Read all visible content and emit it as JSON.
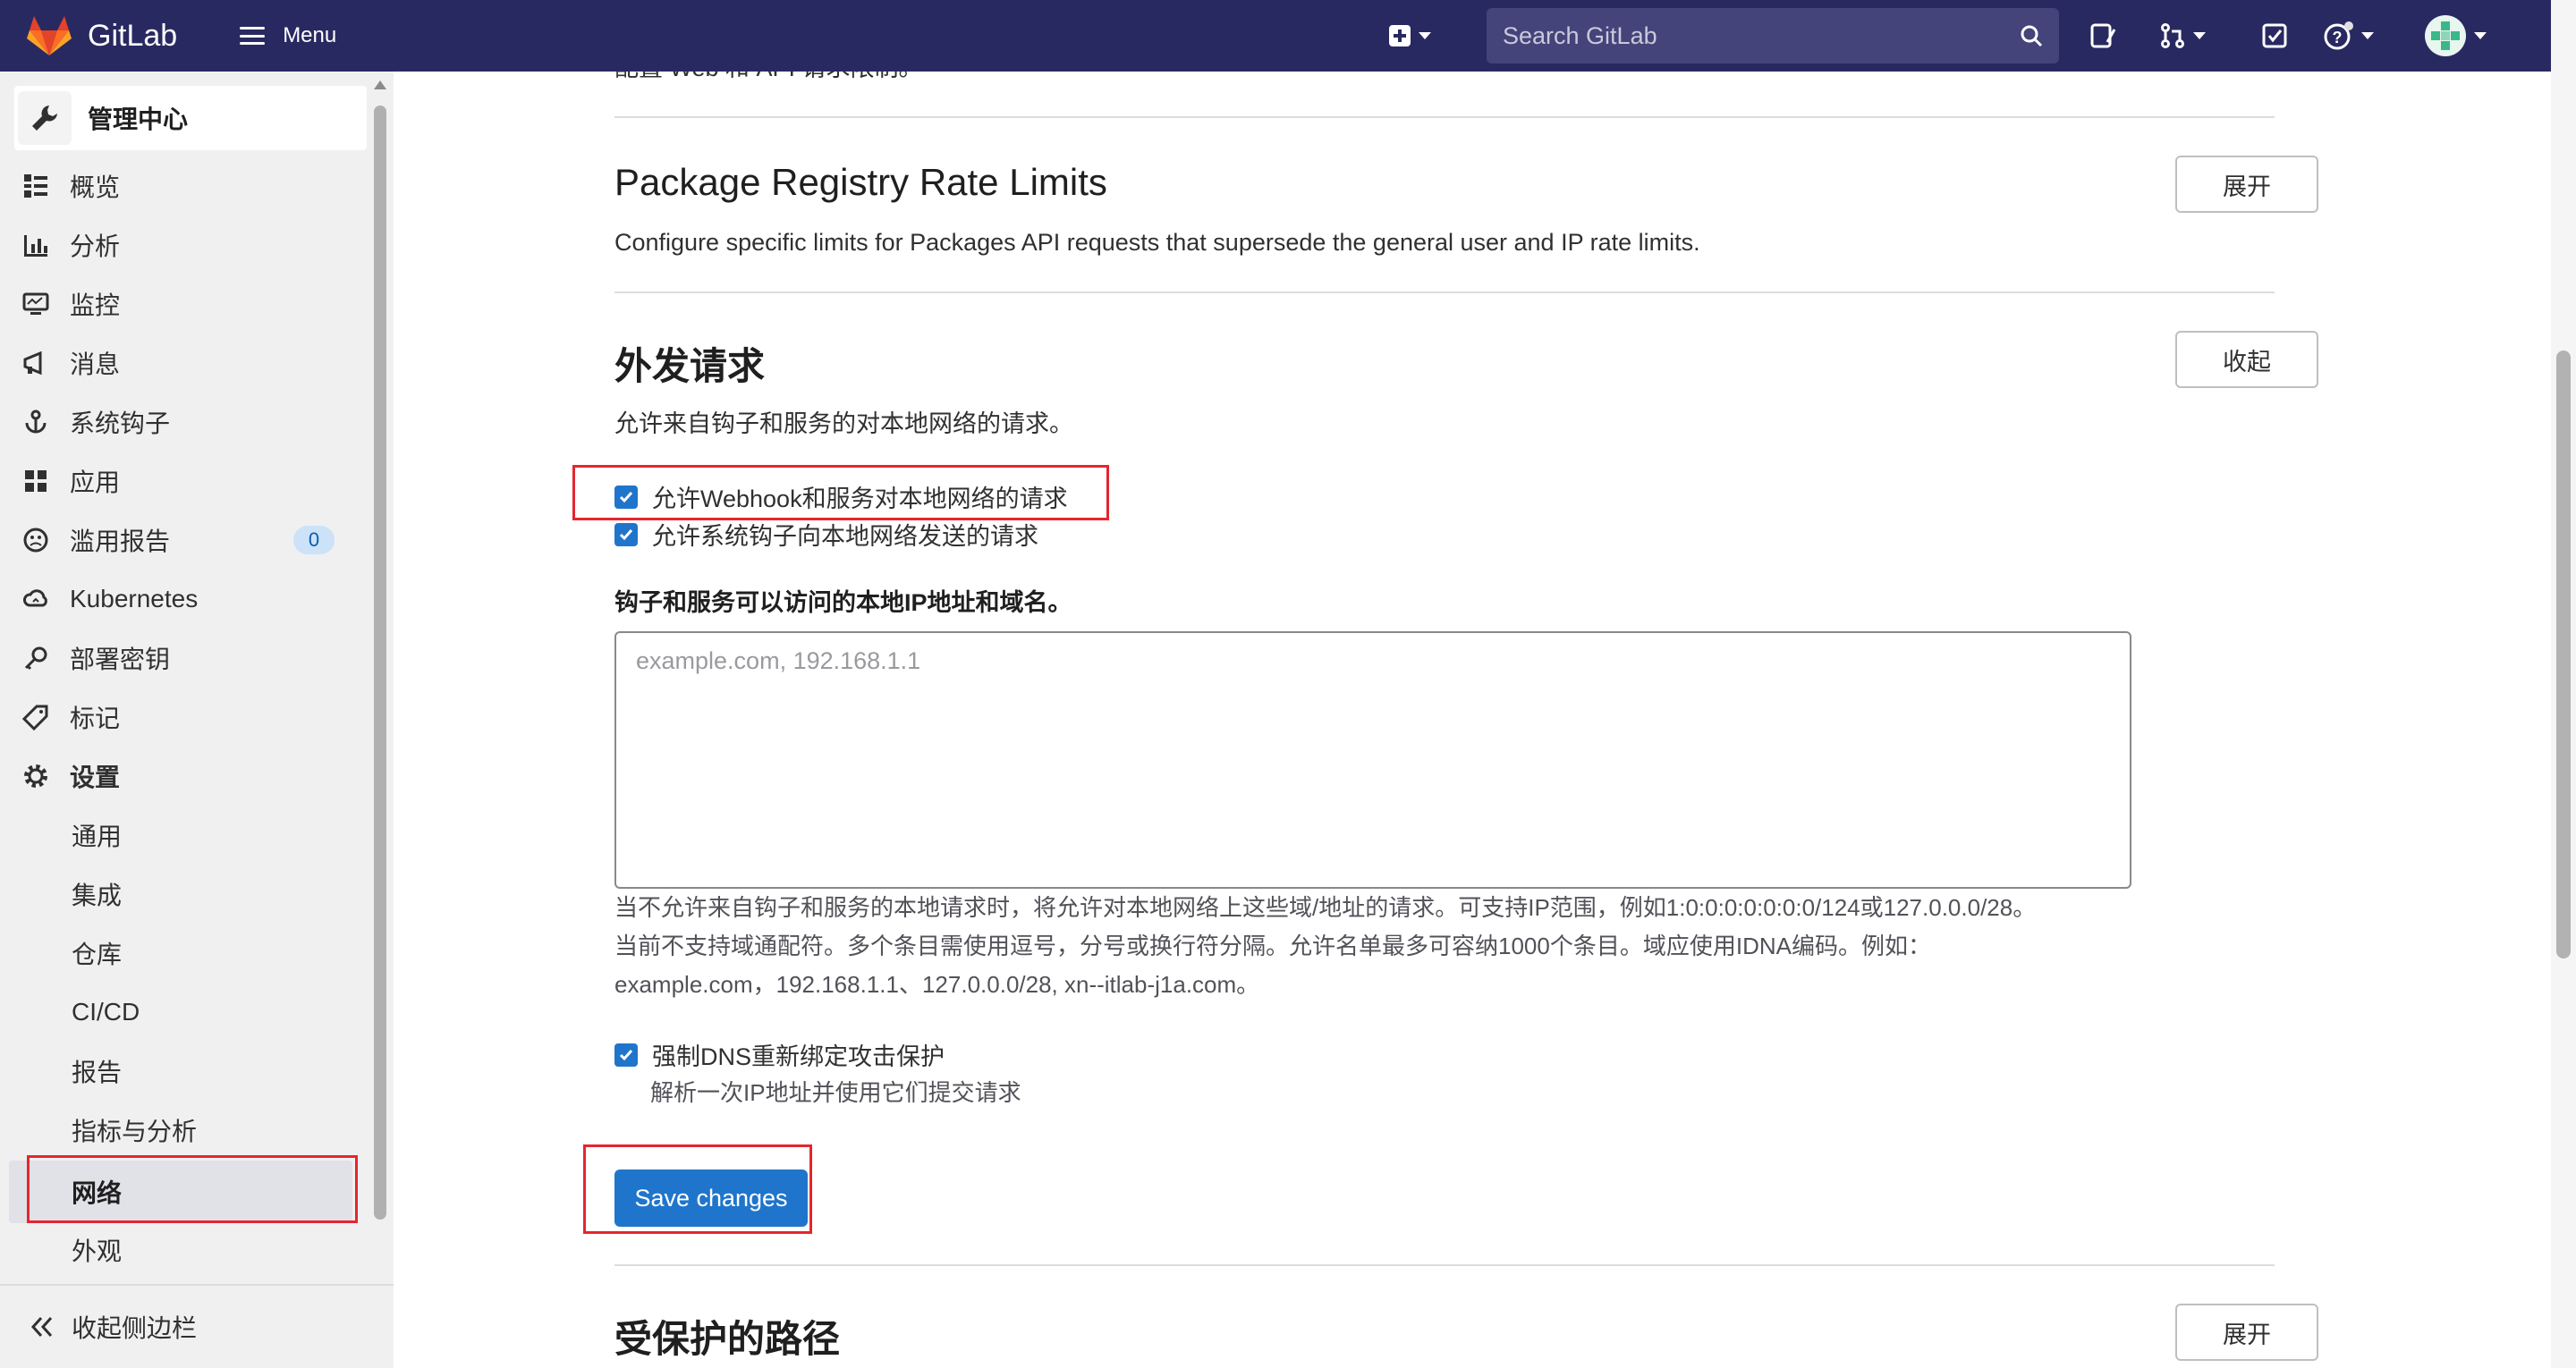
{
  "topbar": {
    "brand": "GitLab",
    "menu_label": "Menu",
    "search_placeholder": "Search GitLab",
    "icons": [
      "create-new-icon",
      "search-icon",
      "issues-icon",
      "merge-requests-icon",
      "todos-icon",
      "help-icon",
      "user-avatar"
    ]
  },
  "sidebar": {
    "header": "管理中心",
    "items": [
      {
        "label": "概览",
        "icon": "overview-icon"
      },
      {
        "label": "分析",
        "icon": "analytics-icon"
      },
      {
        "label": "监控",
        "icon": "monitor-icon"
      },
      {
        "label": "消息",
        "icon": "messages-icon"
      },
      {
        "label": "系统钩子",
        "icon": "hook-icon"
      },
      {
        "label": "应用",
        "icon": "applications-icon"
      },
      {
        "label": "滥用报告",
        "icon": "abuse-icon",
        "badge": "0"
      },
      {
        "label": "Kubernetes",
        "icon": "kubernetes-icon"
      },
      {
        "label": "部署密钥",
        "icon": "key-icon"
      },
      {
        "label": "标记",
        "icon": "label-icon"
      },
      {
        "label": "设置",
        "icon": "settings-icon"
      }
    ],
    "sub_items": [
      "通用",
      "集成",
      "仓库",
      "CI/CD",
      "报告",
      "指标与分析",
      "网络",
      "外观"
    ],
    "active_sub": "网络",
    "collapse_label": "收起侧边栏"
  },
  "content": {
    "cut_off_text": "配置 Web 和 API 请求限制。",
    "package_section": {
      "title": "Package Registry Rate Limits",
      "description": "Configure specific limits for Packages API requests that supersede the general user and IP rate limits.",
      "button": "展开"
    },
    "outbound_section": {
      "title": "外发请求",
      "description": "允许来自钩子和服务的对本地网络的请求。",
      "button": "收起",
      "checkbox1": "允许Webhook和服务对本地网络的请求",
      "checkbox2": "允许系统钩子向本地网络发送的请求",
      "allowlist_label": "钩子和服务可以访问的本地IP地址和域名。",
      "allowlist_placeholder": "example.com, 192.168.1.1",
      "help_line1": "当不允许来自钩子和服务的本地请求时，将允许对本地网络上这些域/地址的请求。可支持IP范围，例如1:0:0:0:0:0:0:0/124或127.0.0.0/28。",
      "help_line2": "当前不支持域通配符。多个条目需使用逗号，分号或换行符分隔。允许名单最多可容纳1000个条目。域应使用IDNA编码。例如：",
      "help_line3": "example.com，192.168.1.1、127.0.0.0/28, xn--itlab-j1a.com。",
      "dns_checkbox": "强制DNS重新绑定攻击保护",
      "dns_help": "解析一次IP地址并使用它们提交请求",
      "save_button": "Save changes"
    },
    "protected_section": {
      "title": "受保护的路径",
      "button": "展开"
    }
  },
  "colors": {
    "navbar": "#292961",
    "primary": "#1f75cb",
    "highlight": "#e5262e"
  }
}
